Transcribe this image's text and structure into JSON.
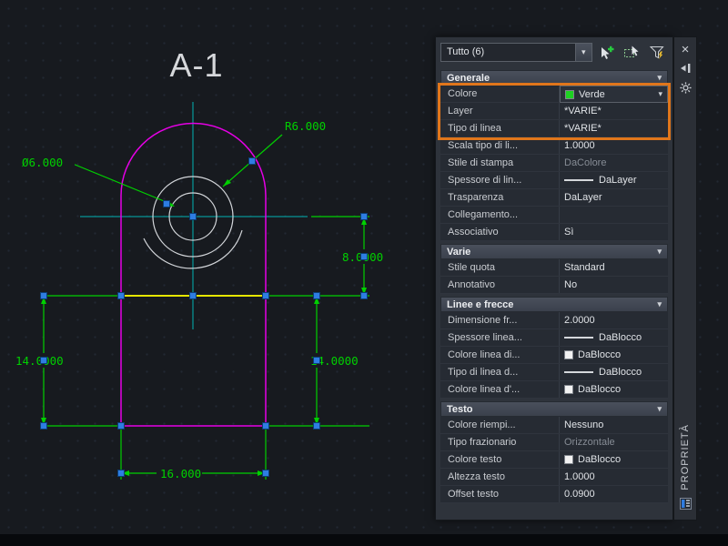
{
  "colors": {
    "highlight": "#e0761b",
    "dimension": "#00d000",
    "magenta": "#e500e5",
    "yellow": "#e6e600",
    "centerline": "#00b3b3",
    "grip": "#2e7de2",
    "verde_swatch": "#1dd121",
    "canvas_bg": "#171a1f"
  },
  "icons": {
    "close": "×",
    "chevron": "▾",
    "dropdown": "▾"
  },
  "canvas": {
    "title": "A-1",
    "dimensions": {
      "radius": "R6.000",
      "diameter": "Ø6.000",
      "height_right": "8.0000",
      "left": "14.0000",
      "right": "14.0000",
      "bottom": "16.000"
    }
  },
  "palette": {
    "title": "PROPRIETÀ",
    "selector": {
      "value": "Tutto (6)"
    },
    "sections": [
      {
        "title": "Generale",
        "rows": [
          {
            "label": "Colore",
            "value": "Verde",
            "swatch": "#1dd121",
            "dropdown": true,
            "highlight": true
          },
          {
            "label": "Layer",
            "value": "*VARIE*",
            "highlight": true
          },
          {
            "label": "Tipo di linea",
            "value": "*VARIE*",
            "highlight": true
          },
          {
            "label": "Scala tipo di li...",
            "value": "1.0000"
          },
          {
            "label": "Stile di stampa",
            "value": "DaColore",
            "muted": true
          },
          {
            "label": "Spessore di lin...",
            "value": "DaLayer",
            "line": true
          },
          {
            "label": "Trasparenza",
            "value": "DaLayer"
          },
          {
            "label": "Collegamento...",
            "value": ""
          },
          {
            "label": "Associativo",
            "value": "Sì"
          }
        ]
      },
      {
        "title": "Varie",
        "rows": [
          {
            "label": "Stile quota",
            "value": "Standard"
          },
          {
            "label": "Annotativo",
            "value": "No"
          }
        ]
      },
      {
        "title": "Linee e frecce",
        "rows": [
          {
            "label": "Dimensione fr...",
            "value": "2.0000"
          },
          {
            "label": "Spessore  linea...",
            "value": "DaBlocco",
            "line": true
          },
          {
            "label": "Colore linea di...",
            "value": "DaBlocco",
            "swatch": "#f2f2f2"
          },
          {
            "label": "Tipo di linea d...",
            "value": "DaBlocco",
            "line": true
          },
          {
            "label": "Colore linea d'...",
            "value": "DaBlocco",
            "swatch": "#f2f2f2"
          }
        ]
      },
      {
        "title": "Testo",
        "rows": [
          {
            "label": "Colore riempi...",
            "value": "Nessuno"
          },
          {
            "label": "Tipo frazionario",
            "value": "Orizzontale",
            "muted": true
          },
          {
            "label": "Colore testo",
            "value": "DaBlocco",
            "swatch": "#f2f2f2"
          },
          {
            "label": "Altezza testo",
            "value": "1.0000"
          },
          {
            "label": "Offset testo",
            "value": "0.0900"
          }
        ]
      }
    ]
  }
}
